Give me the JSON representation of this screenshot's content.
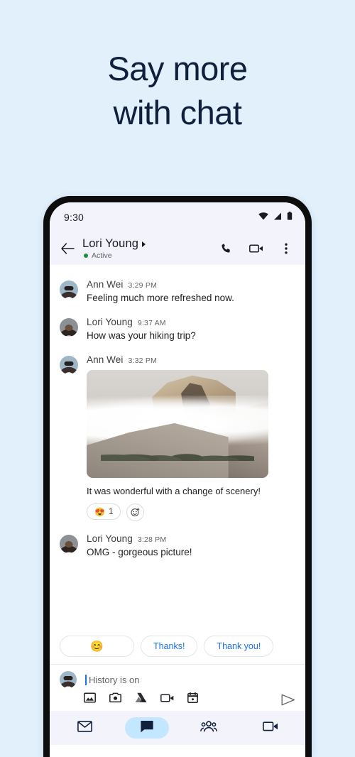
{
  "promo": {
    "headline_line1": "Say more",
    "headline_line2": "with chat",
    "bg_color": "#e1f0fb",
    "text_color": "#10203c"
  },
  "phone": {
    "status_bar": {
      "time": "9:30",
      "icons": [
        "wifi-icon",
        "cellular-signal-icon",
        "battery-icon"
      ]
    },
    "conversation_header": {
      "back_icon": "back-arrow-icon",
      "title": "Lori Young",
      "title_caret": "expand-caret-icon",
      "presence": "Active",
      "presence_color": "#1e8e3e",
      "actions": [
        "phone-call-icon",
        "video-call-icon",
        "overflow-menu-icon"
      ]
    },
    "messages": [
      {
        "sender": "Ann Wei",
        "time": "3:29 PM",
        "text": "Feeling much more refreshed now.",
        "avatar": "ann-wei-avatar"
      },
      {
        "sender": "Lori Young",
        "time": "9:37 AM",
        "text": "How was your hiking trip?",
        "avatar": "lori-young-avatar"
      },
      {
        "sender": "Ann Wei",
        "time": "3:32 PM",
        "attachment": "mountain-photo",
        "caption": "It was wonderful with a change of scenery!",
        "avatar": "ann-wei-avatar",
        "reaction_emoji": "😍",
        "reaction_count": "1",
        "add_reaction_icon": "add-reaction-icon"
      },
      {
        "sender": "Lori Young",
        "time": "3:28 PM",
        "text": "OMG - gorgeous picture!",
        "avatar": "lori-young-avatar"
      }
    ],
    "smart_replies": [
      {
        "type": "emoji",
        "label": "😊"
      },
      {
        "type": "text",
        "label": "Thanks!"
      },
      {
        "type": "text",
        "label": "Thank you!"
      }
    ],
    "smart_reply_color": "#1a73e8",
    "composer": {
      "avatar": "self-avatar",
      "placeholder": "History is on",
      "value": "",
      "attachments": [
        "image-gallery-icon",
        "camera-icon",
        "google-drive-icon",
        "video-icon",
        "calendar-icon"
      ],
      "send_icon": "send-icon"
    },
    "bottom_nav": {
      "items": [
        {
          "name": "mail-tab",
          "icon": "mail-icon",
          "active": false
        },
        {
          "name": "chat-tab",
          "icon": "chat-bubble-icon",
          "active": true
        },
        {
          "name": "spaces-tab",
          "icon": "people-group-icon",
          "active": false
        },
        {
          "name": "meet-tab",
          "icon": "video-camera-icon",
          "active": false
        }
      ],
      "active_pill_color": "#c2e7ff"
    }
  }
}
